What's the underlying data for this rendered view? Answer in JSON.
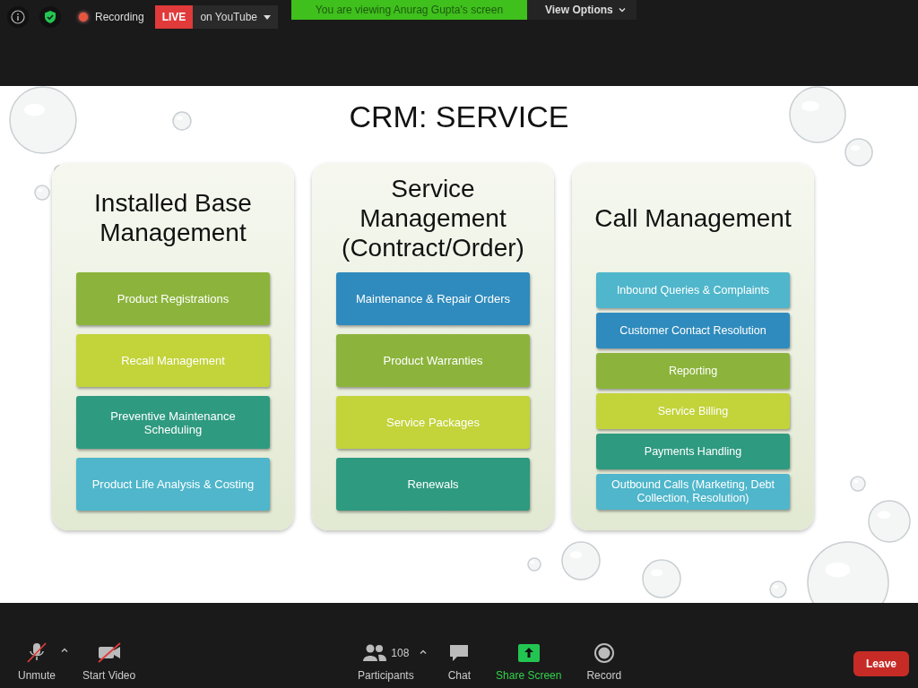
{
  "top_bar": {
    "recording": {
      "label": "Recording"
    },
    "live": {
      "badge": "LIVE",
      "label": "on YouTube"
    },
    "banner": "You are viewing Anurag Gupta's screen",
    "view_options": "View Options"
  },
  "slide": {
    "title": "CRM: SERVICE",
    "columns": [
      {
        "title": "Installed Base Management",
        "items": [
          {
            "label": "Product Registrations",
            "color": "#8cb43c"
          },
          {
            "label": "Recall Management",
            "color": "#c3d33a"
          },
          {
            "label": "Preventive Maintenance Scheduling",
            "color": "#2e9a80"
          },
          {
            "label": "Product Life Analysis & Costing",
            "color": "#4fb6cb"
          }
        ]
      },
      {
        "title": "Service Management (Contract/Order)",
        "items": [
          {
            "label": "Maintenance & Repair Orders",
            "color": "#2f8bbd"
          },
          {
            "label": "Product Warranties",
            "color": "#8cb43c"
          },
          {
            "label": "Service Packages",
            "color": "#c3d33a"
          },
          {
            "label": "Renewals",
            "color": "#2e9a80"
          }
        ]
      },
      {
        "title": "Call Management",
        "items": [
          {
            "label": "Inbound Queries & Complaints",
            "color": "#4fb6cb"
          },
          {
            "label": "Customer Contact Resolution",
            "color": "#2f8bbd"
          },
          {
            "label": "Reporting",
            "color": "#8cb43c"
          },
          {
            "label": "Service Billing",
            "color": "#c3d33a"
          },
          {
            "label": "Payments Handling",
            "color": "#2e9a80"
          },
          {
            "label": "Outbound Calls (Marketing, Debt Collection,  Resolution)",
            "color": "#4fb6cb"
          }
        ]
      }
    ]
  },
  "toolbar": {
    "left": [
      {
        "kind": "mic",
        "label": "Unmute"
      },
      {
        "kind": "video",
        "label": "Start Video"
      }
    ],
    "center": [
      {
        "kind": "participants",
        "label": "Participants",
        "count": "108"
      },
      {
        "kind": "chat",
        "label": "Chat"
      },
      {
        "kind": "share",
        "label": "Share Screen"
      },
      {
        "kind": "record",
        "label": "Record"
      }
    ],
    "leave": "Leave"
  }
}
